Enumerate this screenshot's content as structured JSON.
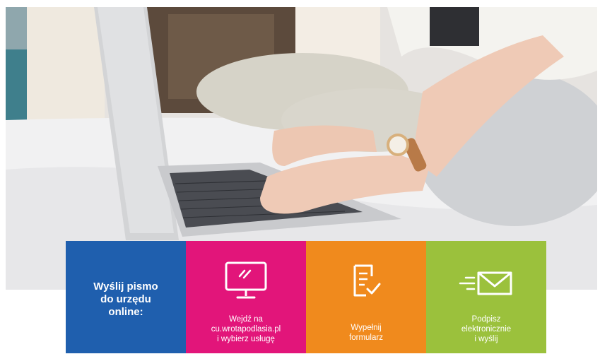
{
  "banner": {
    "hero_image": "woman-typing-on-laptop-photo",
    "title": "Wyślij pismo\ndo urzędu\nonline:",
    "steps": [
      {
        "icon": "computer-monitor-icon",
        "label": "Wejdź na\ncu.wrotapodlasia.pl\ni wybierz usługę",
        "color": "#e2157a"
      },
      {
        "icon": "form-document-check-icon",
        "label": "Wypełnij\nformularz",
        "color": "#f08a1d"
      },
      {
        "icon": "envelope-send-icon",
        "label": "Podpisz\nelektronicznie\ni wyślij",
        "color": "#9bc13c"
      }
    ],
    "title_color": "#1f5fae"
  }
}
